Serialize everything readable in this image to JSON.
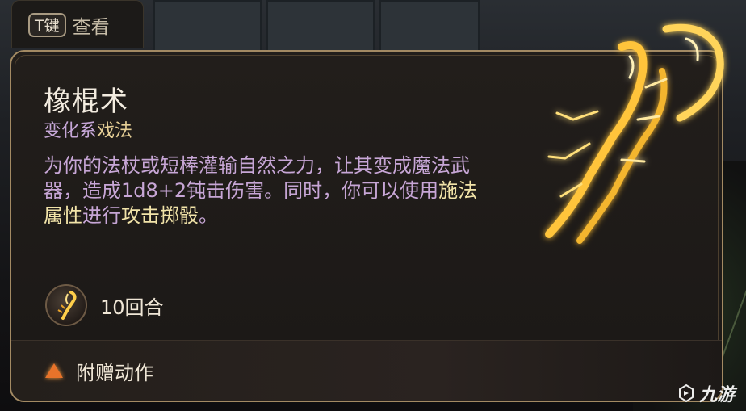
{
  "hint": {
    "key": "T键",
    "label": "查看"
  },
  "spell": {
    "name": "橡棍术",
    "school": "变化系",
    "type": "戏法",
    "description_parts": [
      {
        "text": "为你的法杖或短棒灌输自然之力，让其变成魔法武器，造成1d8+2钝击伤害。同时，你可以使用",
        "highlight": false
      },
      {
        "text": "施法属性",
        "highlight": true
      },
      {
        "text": "进行",
        "highlight": false
      },
      {
        "text": "攻击掷骰",
        "highlight": true
      },
      {
        "text": "。",
        "highlight": false
      }
    ],
    "duration": "10回合",
    "cost": "附赠动作"
  },
  "icons": {
    "duration": "staff-glow-icon",
    "cost": "bonus-action-triangle-icon",
    "art": "shillelagh-staff-icon"
  },
  "colors": {
    "panel_border": "#a38a63",
    "description": "#c7a6d6",
    "highlight": "#f1e3a8",
    "bonus_action": "#e8732a",
    "glow": "#ffd45a"
  },
  "watermark": {
    "text": "九游"
  }
}
